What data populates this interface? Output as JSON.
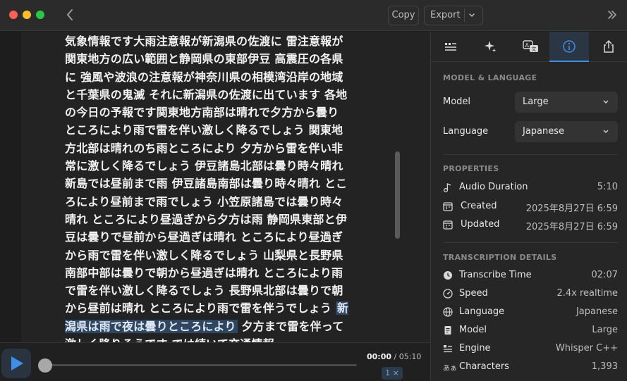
{
  "toolbar": {
    "back_icon": "chevron-left-icon",
    "copy_label": "Copy",
    "export_label": "Export",
    "sidebar_toggle_icon": "double-chevron-right-icon"
  },
  "transcript": {
    "text_before": "気象情報です大雨注意報が新潟県の佐渡に 雷注意報が関東地方の広い範囲と静岡県の東部伊豆 高震圧の各県に 強風や波浪の注意報が神奈川県の相模湾沿岸の地域と千葉県の鬼滅 それに新潟県の佐渡に出ています 各地の今日の予報です関東地方南部は晴れで夕方から曇り ところにより雨で雷を伴い激しく降るでしょう 関東地方北部は晴れのち雨ところにより 夕方から雷を伴い非常に激しく降るでしょう 伊豆諸島北部は曇り時々晴れ 新島では昼前まで雨 伊豆諸島南部は曇り時々晴れ ところにより昼前まで雨でしょう 小笠原諸島では曇り時々晴れ ところにより昼過ぎから夕方は雨 静岡県東部と伊豆は曇りで昼前から昼過ぎは晴れ ところにより昼過ぎから雨で雷を伴い激しく降るでしょう 山梨県と長野県南部中部は曇りで朝から昼過ぎは晴れ ところにより雨で雷を伴い激しく降るでしょう 長野県北部は曇りで朝から昼前は晴れ ところにより雨で雷を伴うでしょう ",
    "text_highlighted": "新潟県は雨で夜は曇りところにより",
    "text_after": " 夕方まで雷を伴って激しく降りそうです では続いて交通情報"
  },
  "player": {
    "current_time": "00:00",
    "separator": " / ",
    "total_time": "05:10",
    "speed_label": "1 ×",
    "progress": 0
  },
  "sidebar": {
    "tabs": [
      {
        "name": "transcript-tab",
        "icon": "quote-list-icon"
      },
      {
        "name": "ai-tab",
        "icon": "sparkles-icon"
      },
      {
        "name": "translate-tab",
        "icon": "translate-icon"
      },
      {
        "name": "info-tab",
        "icon": "info-icon",
        "active": true
      },
      {
        "name": "share-tab",
        "icon": "share-icon"
      }
    ],
    "model_language": {
      "title": "MODEL & LANGUAGE",
      "model_label": "Model",
      "model_value": "Large",
      "language_label": "Language",
      "language_value": "Japanese"
    },
    "properties": {
      "title": "PROPERTIES",
      "audio_duration_label": "Audio Duration",
      "audio_duration_value": "5:10",
      "created_label": "Created",
      "created_value": "2025年8月27日 6:59",
      "updated_label": "Updated",
      "updated_value": "2025年8月27日 6:59"
    },
    "details": {
      "title": "TRANSCRIPTION DETAILS",
      "transcribe_time_label": "Transcribe Time",
      "transcribe_time_value": "02:07",
      "speed_label": "Speed",
      "speed_value": "2.4x realtime",
      "language_label": "Language",
      "language_value": "Japanese",
      "model_label": "Model",
      "model_value": "Large",
      "engine_label": "Engine",
      "engine_value": "Whisper C++",
      "characters_label": "Characters",
      "characters_value": "1,393",
      "characters_icon_text": "あぁ"
    }
  },
  "colors": {
    "accent": "#3d8fe8",
    "highlight_bg": "#2f4660"
  }
}
